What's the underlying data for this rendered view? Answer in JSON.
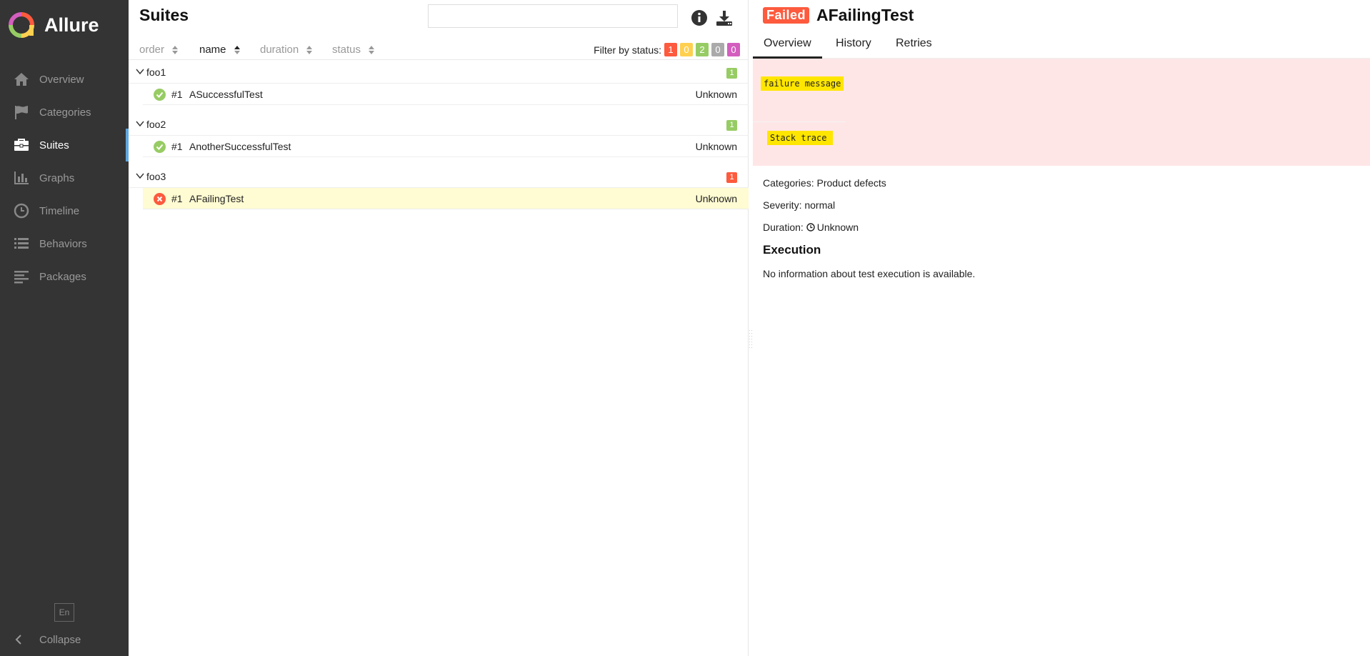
{
  "app": {
    "name": "Allure"
  },
  "sidebar": {
    "items": [
      {
        "label": "Overview",
        "icon": "home-icon",
        "active": false
      },
      {
        "label": "Categories",
        "icon": "flag-icon",
        "active": false
      },
      {
        "label": "Suites",
        "icon": "briefcase-icon",
        "active": true
      },
      {
        "label": "Graphs",
        "icon": "bar-chart-icon",
        "active": false
      },
      {
        "label": "Timeline",
        "icon": "clock-icon",
        "active": false
      },
      {
        "label": "Behaviors",
        "icon": "list-icon",
        "active": false
      },
      {
        "label": "Packages",
        "icon": "align-left-icon",
        "active": false
      }
    ],
    "language": "En",
    "collapse_label": "Collapse"
  },
  "suites": {
    "title": "Suites",
    "search_value": "",
    "sort": {
      "order": "order",
      "name": "name",
      "duration": "duration",
      "status": "status"
    },
    "filter_label": "Filter by status:",
    "filter_counts": [
      {
        "value": "1",
        "color": "#fd5a3e"
      },
      {
        "value": "0",
        "color": "#ffd050"
      },
      {
        "value": "2",
        "color": "#97cc64"
      },
      {
        "value": "0",
        "color": "#aaaaaa"
      },
      {
        "value": "0",
        "color": "#d35ebe"
      }
    ],
    "groups": [
      {
        "name": "foo1",
        "count": "1",
        "count_color": "#97cc64",
        "test": {
          "num": "#1",
          "name": "ASuccessfulTest",
          "duration": "Unknown",
          "status": "passed"
        }
      },
      {
        "name": "foo2",
        "count": "1",
        "count_color": "#97cc64",
        "test": {
          "num": "#1",
          "name": "AnotherSuccessfulTest",
          "duration": "Unknown",
          "status": "passed"
        }
      },
      {
        "name": "foo3",
        "count": "1",
        "count_color": "#fd5a3e",
        "test": {
          "num": "#1",
          "name": "AFailingTest",
          "duration": "Unknown",
          "status": "failed"
        }
      }
    ]
  },
  "testcase": {
    "status": "Failed",
    "title": "AFailingTest",
    "tabs": [
      "Overview",
      "History",
      "Retries"
    ],
    "failure_message": "failure message",
    "stack_trace_label": "Stack trace",
    "categories_label": "Categories:",
    "categories_value": "Product defects",
    "severity_label": "Severity:",
    "severity_value": "normal",
    "duration_label": "Duration:",
    "duration_value": "Unknown",
    "execution_title": "Execution",
    "execution_text": "No information about test execution is available."
  },
  "colors": {
    "sidebar_bg": "#343434",
    "accent": "#5fa8e0",
    "failed": "#fd5a3e",
    "passed": "#97cc64",
    "selected_row": "#fffbd2",
    "error_bg": "#ffe6e6",
    "highlight": "#ffe600"
  }
}
